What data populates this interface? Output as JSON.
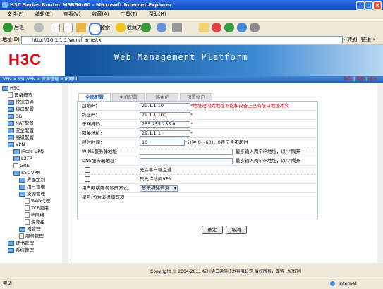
{
  "window": {
    "title": "H3C Series Router MSR50-60 - Microsoft Internet Explorer"
  },
  "menu": [
    "文件(F)",
    "编辑(E)",
    "查看(V)",
    "收藏(A)",
    "工具(T)",
    "帮助(H)"
  ],
  "toolbar": {
    "back": "后退",
    "search": "搜索",
    "favorites": "收藏夹"
  },
  "address": {
    "label": "地址(D)",
    "url": "http://16.1.1.1/wcn/frame/.x",
    "go": "转到",
    "links": "链接 »"
  },
  "banner": {
    "logo": "H3C",
    "title": "Web Management Platform"
  },
  "breadcrumb": {
    "path": "VPN > SSL VPN > 资源管理 > IP网络",
    "save": "保存",
    "help": "帮助",
    "logout": "退出",
    "sep": "|"
  },
  "sidebar": {
    "items": [
      {
        "label": "H3C",
        "type": "root",
        "indent": 0
      },
      {
        "label": "设备概览",
        "type": "page",
        "indent": 1
      },
      {
        "label": "快速向导",
        "type": "folder",
        "indent": 1
      },
      {
        "label": "接口配置",
        "type": "folder",
        "indent": 1
      },
      {
        "label": "3G",
        "type": "folder",
        "indent": 1
      },
      {
        "label": "NAT配置",
        "type": "folder",
        "indent": 1
      },
      {
        "label": "安全配置",
        "type": "folder",
        "indent": 1
      },
      {
        "label": "高级配置",
        "type": "folder",
        "indent": 1
      },
      {
        "label": "VPN",
        "type": "folder",
        "indent": 1
      },
      {
        "label": "IPsec VPN",
        "type": "folder",
        "indent": 2
      },
      {
        "label": "L2TP",
        "type": "folder",
        "indent": 2
      },
      {
        "label": "GRE",
        "type": "page",
        "indent": 2
      },
      {
        "label": "SSL VPN",
        "type": "folder",
        "indent": 2
      },
      {
        "label": "界面定制",
        "type": "folder",
        "indent": 3
      },
      {
        "label": "用户管理",
        "type": "folder",
        "indent": 3
      },
      {
        "label": "资源管理",
        "type": "folder",
        "indent": 3
      },
      {
        "label": "Web代理",
        "type": "page",
        "indent": 4
      },
      {
        "label": "TCP应用",
        "type": "page",
        "indent": 4
      },
      {
        "label": "IP网络",
        "type": "page",
        "indent": 4
      },
      {
        "label": "资源组",
        "type": "page",
        "indent": 4
      },
      {
        "label": "域管理",
        "type": "folder",
        "indent": 3
      },
      {
        "label": "服务管理",
        "type": "page",
        "indent": 3
      },
      {
        "label": "证书管理",
        "type": "folder",
        "indent": 1
      },
      {
        "label": "系统管理",
        "type": "folder",
        "indent": 1
      }
    ]
  },
  "tabs": [
    "全局配置",
    "主机配置",
    "路由IP",
    "预置帐户"
  ],
  "form": {
    "start_ip": {
      "label": "起始IP：",
      "value": "29.1.1.10",
      "note": "*地址池内的地址不能和设备上已有接口地址冲突"
    },
    "end_ip": {
      "label": "终止IP：",
      "value": "29.1.1.100",
      "note": "*"
    },
    "mask": {
      "label": "子网掩码：",
      "value": "255.255.255.0",
      "note": "*"
    },
    "gateway": {
      "label": "网关地址：",
      "value": "29.1.1.1",
      "note": "*"
    },
    "timeout": {
      "label": "超时时间：",
      "value": "10",
      "note": "*分钟(0～60)，0表示永不超时"
    },
    "wins": {
      "label": "WINS服务器地址：",
      "value": "",
      "note": "最多输入两个IP地址，以\";\"隔开"
    },
    "dns": {
      "label": "DNS服务器地址：",
      "value": "",
      "note": "最多输入两个IP地址，以\";\"隔开"
    },
    "allow_client": {
      "label": "允许客户端互通"
    },
    "only_vpn": {
      "label": "只允许访问VPN"
    },
    "display_mode": {
      "label": "用户网络服务显示方式：",
      "value": "显示描述信息"
    },
    "required_hint": "星号(*)为必须填写项",
    "ok": "确定",
    "cancel": "取消"
  },
  "footer": "Copyright © 2004-2011 杭州华三通信技术有限公司 版权所有，保留一切权利",
  "status": {
    "left": "完毕",
    "zone": "Internet"
  }
}
